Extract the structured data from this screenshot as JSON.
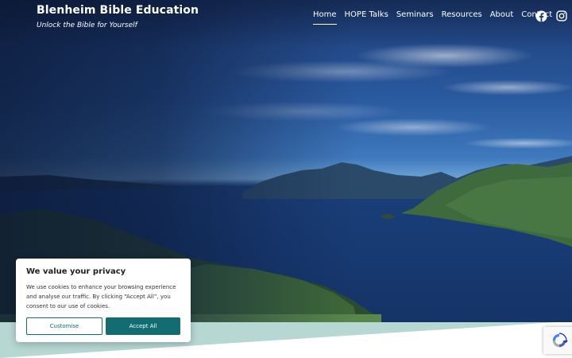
{
  "site": {
    "title": "Blenheim Bible Education",
    "tagline": "Unlock the Bible for Yourself"
  },
  "nav": {
    "items": [
      {
        "label": "Home",
        "active": true
      },
      {
        "label": "HOPE Talks"
      },
      {
        "label": "Seminars"
      },
      {
        "label": "Resources"
      },
      {
        "label": "About"
      },
      {
        "label": "Contact"
      }
    ]
  },
  "social": {
    "facebook_icon": "facebook-icon",
    "instagram_icon": "instagram-icon"
  },
  "cookie_banner": {
    "title": "We value your privacy",
    "text": "We use cookies to enhance your browsing experience and analyse our traffic. By clicking “Accept All”, you consent to our use of cookies.",
    "customise_label": "Customise",
    "accept_label": "Accept All"
  },
  "colors": {
    "accent": "#126d72",
    "wave": "#b7d7d3"
  }
}
